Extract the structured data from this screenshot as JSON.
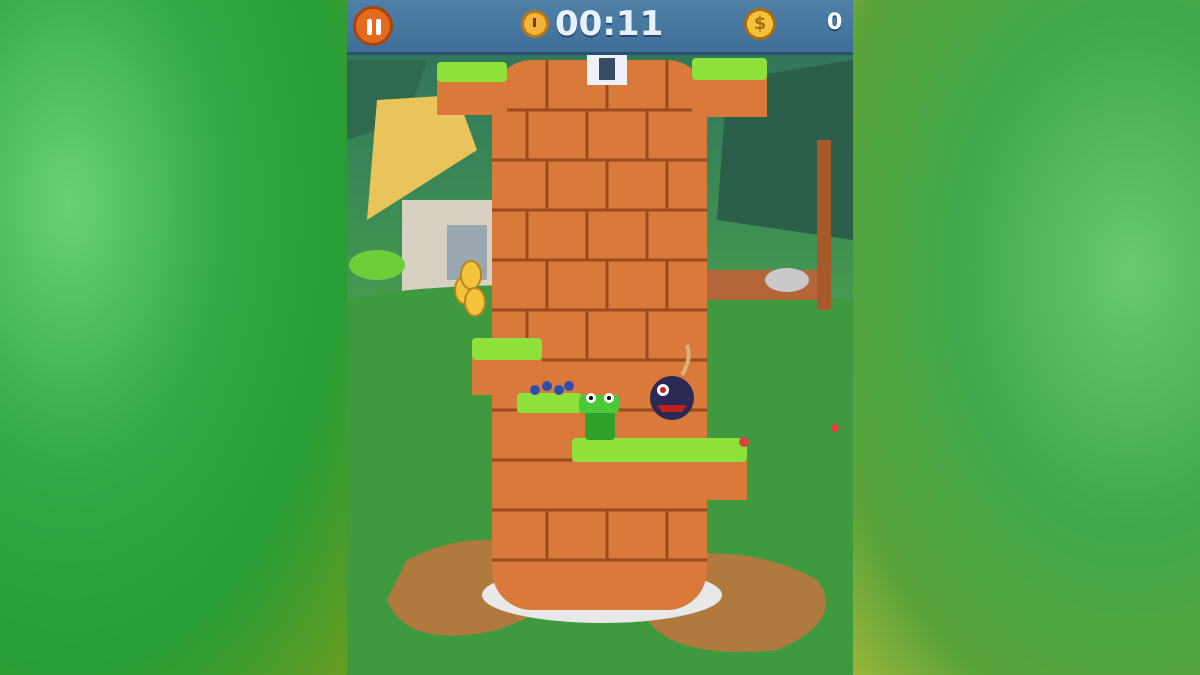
{
  "hud": {
    "timer": "00:11",
    "coins": "0",
    "coin_symbol": "$"
  },
  "icons": [
    "pause-icon",
    "stopwatch-icon",
    "coin-icon"
  ],
  "colors": {
    "hud_bar": "#3f6f98",
    "pause_button": "#e46a1d",
    "tower_brick": "#d9793a",
    "grass": "#8ee03a"
  }
}
